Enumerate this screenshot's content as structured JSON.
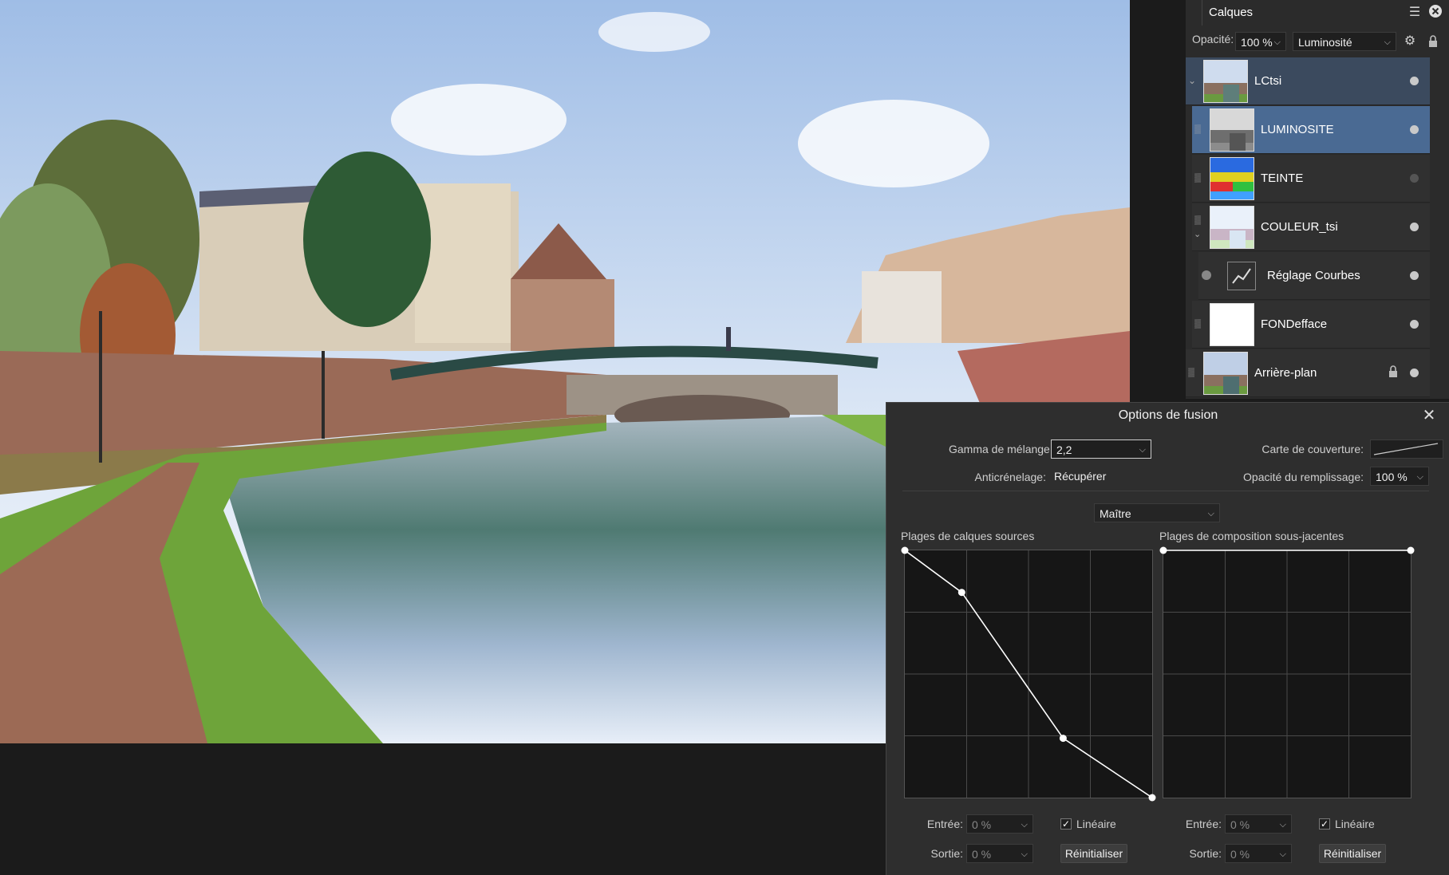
{
  "layers_panel": {
    "tab_label": "Calques",
    "opacity_label": "Opacité:",
    "opacity_value": "100 %",
    "blend_mode": "Luminosité",
    "layers": [
      {
        "name": "LCtsi",
        "thumb": "photo",
        "selected_parent": true,
        "visible": true
      },
      {
        "name": "LUMINOSITE",
        "thumb": "photo-gray",
        "selected": true,
        "visible": true
      },
      {
        "name": "TEINTE",
        "thumb": "hue",
        "visible": false
      },
      {
        "name": "COULEUR_tsi",
        "thumb": "photo-light",
        "visible": true
      },
      {
        "name": "Réglage Courbes",
        "thumb": "curves-icon",
        "visible": true
      },
      {
        "name": "FONDefface",
        "thumb": "white",
        "visible": true
      },
      {
        "name": "Arrière-plan",
        "thumb": "photo",
        "locked": true,
        "visible": true
      }
    ]
  },
  "blend_dialog": {
    "title": "Options de fusion",
    "gamma_label": "Gamma de mélange:",
    "gamma_value": "2,2",
    "coverage_label": "Carte de couverture:",
    "antialias_label": "Anticrénelage:",
    "antialias_value": "Récupérer",
    "fill_opacity_label": "Opacité du remplissage:",
    "fill_opacity_value": "100 %",
    "channel_value": "Maître",
    "source_title": "Plages de calques sources",
    "underlying_title": "Plages de composition sous-jacentes",
    "source_curve": [
      [
        0,
        1
      ],
      [
        0.23,
        0.83
      ],
      [
        0.64,
        0.24
      ],
      [
        1,
        0
      ]
    ],
    "underlying_curve": [
      [
        0,
        1
      ],
      [
        1,
        1
      ]
    ],
    "left": {
      "input_label": "Entrée:",
      "input_value": "0 %",
      "output_label": "Sortie:",
      "output_value": "0 %",
      "linear_label": "Linéaire",
      "linear_checked": true,
      "reset_label": "Réinitialiser"
    },
    "right": {
      "input_label": "Entrée:",
      "input_value": "0 %",
      "output_label": "Sortie:",
      "output_value": "0 %",
      "linear_label": "Linéaire",
      "linear_checked": true,
      "reset_label": "Réinitialiser"
    }
  },
  "colors": {
    "selection": "#4a6a93",
    "panel_bg": "#2b2b2b",
    "dialog_bg": "#2e2e2e"
  }
}
